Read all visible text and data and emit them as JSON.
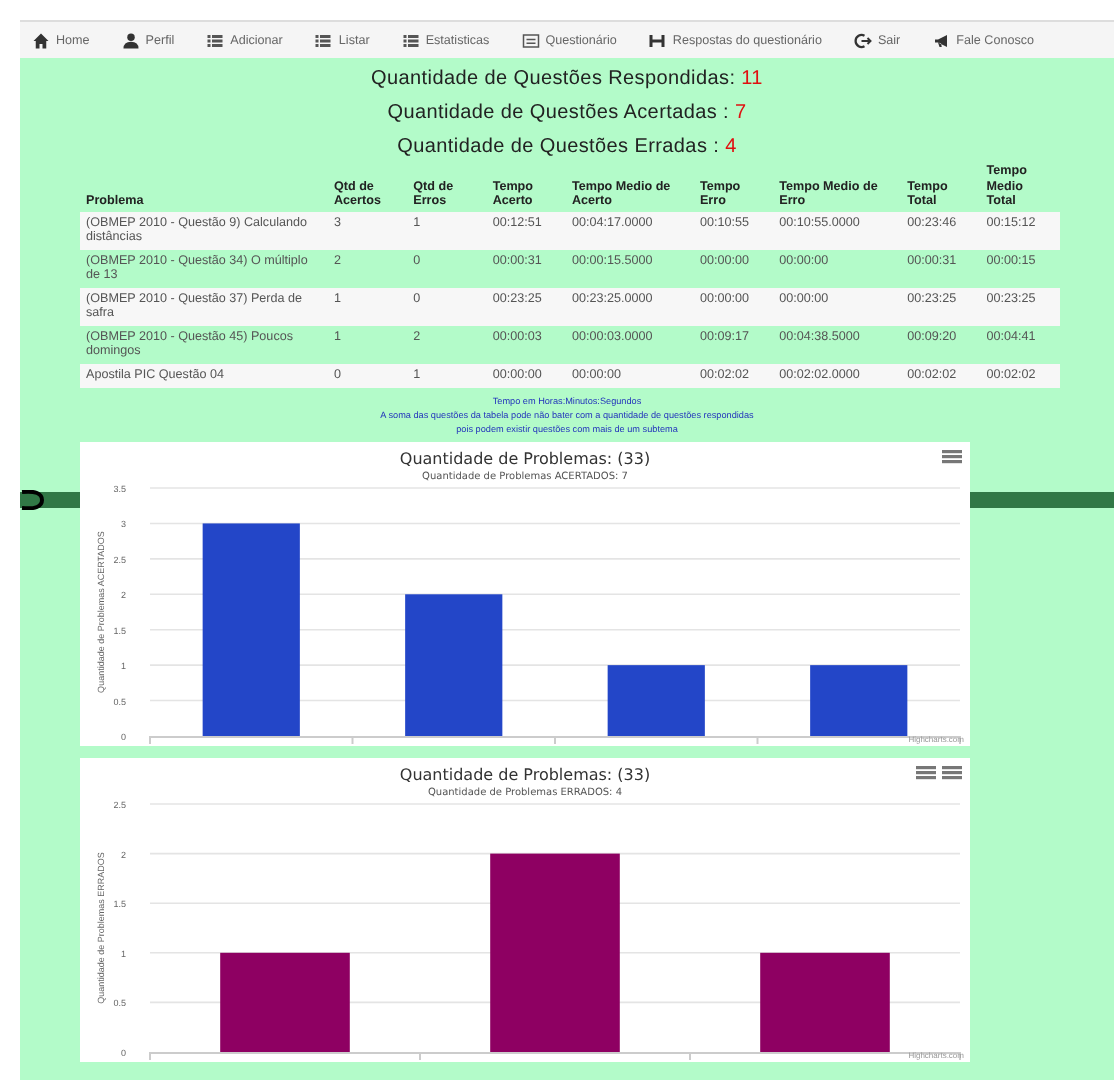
{
  "nav": {
    "items": [
      {
        "label": "Home"
      },
      {
        "label": "Perfil"
      },
      {
        "label": "Adicionar"
      },
      {
        "label": "Listar"
      },
      {
        "label": "Estatisticas"
      },
      {
        "label": "Questionário"
      },
      {
        "label": "Respostas do questionário"
      },
      {
        "label": "Sair"
      },
      {
        "label": "Fale Conosco"
      }
    ]
  },
  "summary": [
    {
      "label": "Quantidade de Questões Respondidas: ",
      "value": "11"
    },
    {
      "label": "Quantidade de Questões Acertadas : ",
      "value": "7"
    },
    {
      "label": "Quantidade de Questões Erradas : ",
      "value": "4"
    }
  ],
  "table": {
    "columns": [
      "Problema",
      "Qtd de Acertos",
      "Qtd de Erros",
      "Tempo Acerto",
      "Tempo Medio de Acerto",
      "Tempo Erro",
      "Tempo Medio de Erro",
      "Tempo Total",
      "Tempo Medio Total"
    ],
    "rows": [
      [
        "(OBMEP 2010 - Questão 9) Calculando distâncias",
        "3",
        "1",
        "00:12:51",
        "00:04:17.0000",
        "00:10:55",
        "00:10:55.0000",
        "00:23:46",
        "00:15:12"
      ],
      [
        "(OBMEP 2010 - Questão 34) O múltiplo de 13",
        "2",
        "0",
        "00:00:31",
        "00:00:15.5000",
        "00:00:00",
        "00:00:00",
        "00:00:31",
        "00:00:15"
      ],
      [
        "(OBMEP 2010 - Questão 37) Perda de safra",
        "1",
        "0",
        "00:23:25",
        "00:23:25.0000",
        "00:00:00",
        "00:00:00",
        "00:23:25",
        "00:23:25"
      ],
      [
        "(OBMEP 2010 - Questão 45) Poucos domingos",
        "1",
        "2",
        "00:00:03",
        "00:00:03.0000",
        "00:09:17",
        "00:04:38.5000",
        "00:09:20",
        "00:04:41"
      ],
      [
        "Apostila PIC Questão 04",
        "0",
        "1",
        "00:00:00",
        "00:00:00",
        "00:02:02",
        "00:02:02.0000",
        "00:02:02",
        "00:02:02"
      ]
    ]
  },
  "notes": [
    "Tempo em Horas:Minutos:Segundos",
    "A soma das questões da tabela pode não bater com a quantidade de questões respondidas",
    "pois podem existir questões com mais de um subtema"
  ],
  "charts": [
    {
      "credits": "Highcharts.com",
      "chart_data": {
        "type": "bar",
        "orientation": "vertical",
        "title": "Quantidade de Problemas: (33)",
        "subtitle": "Quantidade de Problemas ACERTADOS: 7",
        "ylabel": "Quantidade de Problemas ACERTADOS",
        "ylim": [
          0,
          3.5
        ],
        "yticks": [
          0,
          0.5,
          1,
          1.5,
          2,
          2.5,
          3,
          3.5
        ],
        "grid": true,
        "series": [
          {
            "color": "#2346c8",
            "values": [
              3,
              2,
              1,
              1
            ]
          }
        ]
      }
    },
    {
      "credits": "Highcharts.com",
      "chart_data": {
        "type": "bar",
        "orientation": "vertical",
        "title": "Quantidade de Problemas: (33)",
        "subtitle": "Quantidade de Problemas ERRADOS: 4",
        "ylabel": "Quantidade de Problemas ERRADOS",
        "ylim": [
          0,
          2.5
        ],
        "yticks": [
          0,
          0.5,
          1,
          1.5,
          2,
          2.5
        ],
        "grid": true,
        "series": [
          {
            "color": "#8e0062",
            "values": [
              1,
              2,
              1
            ]
          }
        ]
      }
    }
  ]
}
